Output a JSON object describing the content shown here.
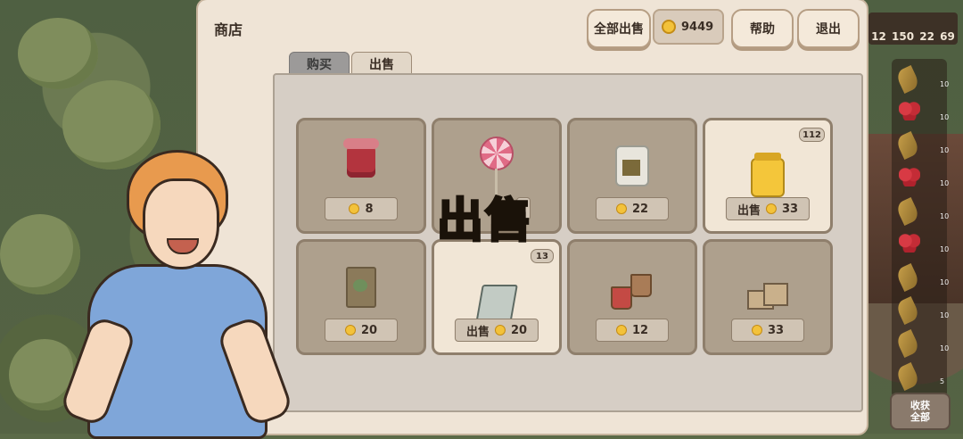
{
  "shop": {
    "title": "商店",
    "sell_all_label": "全部出售",
    "coins": "9449",
    "help_label": "帮助",
    "exit_label": "退出",
    "tabs": {
      "buy": "购买",
      "sell": "出售"
    }
  },
  "items": [
    {
      "name": "jam-jar",
      "price": "8",
      "sell_label": "",
      "qty": ""
    },
    {
      "name": "lollipop",
      "price": "",
      "sell_label": "",
      "qty": ""
    },
    {
      "name": "pickle-jar",
      "price": "22",
      "sell_label": "",
      "qty": ""
    },
    {
      "name": "honey-jar",
      "price": "33",
      "sell_label": "出售",
      "qty": "112"
    },
    {
      "name": "seed-bag",
      "price": "20",
      "sell_label": "",
      "qty": ""
    },
    {
      "name": "notebook",
      "price": "20",
      "sell_label": "出售",
      "qty": "13"
    },
    {
      "name": "cups",
      "price": "12",
      "sell_label": "",
      "qty": ""
    },
    {
      "name": "boxes",
      "price": "33",
      "sell_label": "",
      "qty": ""
    }
  ],
  "overlay": {
    "big_sell": "出售"
  },
  "hud": {
    "counts": [
      "12",
      "150",
      "22",
      "69"
    ]
  },
  "inventory": [
    {
      "icon": "wheat-icon",
      "count": "10"
    },
    {
      "icon": "berry-icon",
      "count": "10"
    },
    {
      "icon": "wheat-icon",
      "count": "10"
    },
    {
      "icon": "berry-icon",
      "count": "10"
    },
    {
      "icon": "wheat-icon",
      "count": "10"
    },
    {
      "icon": "berry-icon",
      "count": "10"
    },
    {
      "icon": "wheat-icon",
      "count": "10"
    },
    {
      "icon": "wheat-icon",
      "count": "10"
    },
    {
      "icon": "wheat-icon",
      "count": "10"
    },
    {
      "icon": "wheat-icon",
      "count": "5"
    }
  ],
  "harvest_all_label": "收获\n全部",
  "colors": {
    "panel": "#efe4d6",
    "coin": "#f3c23a",
    "overlay_text": "#f6bd19"
  }
}
